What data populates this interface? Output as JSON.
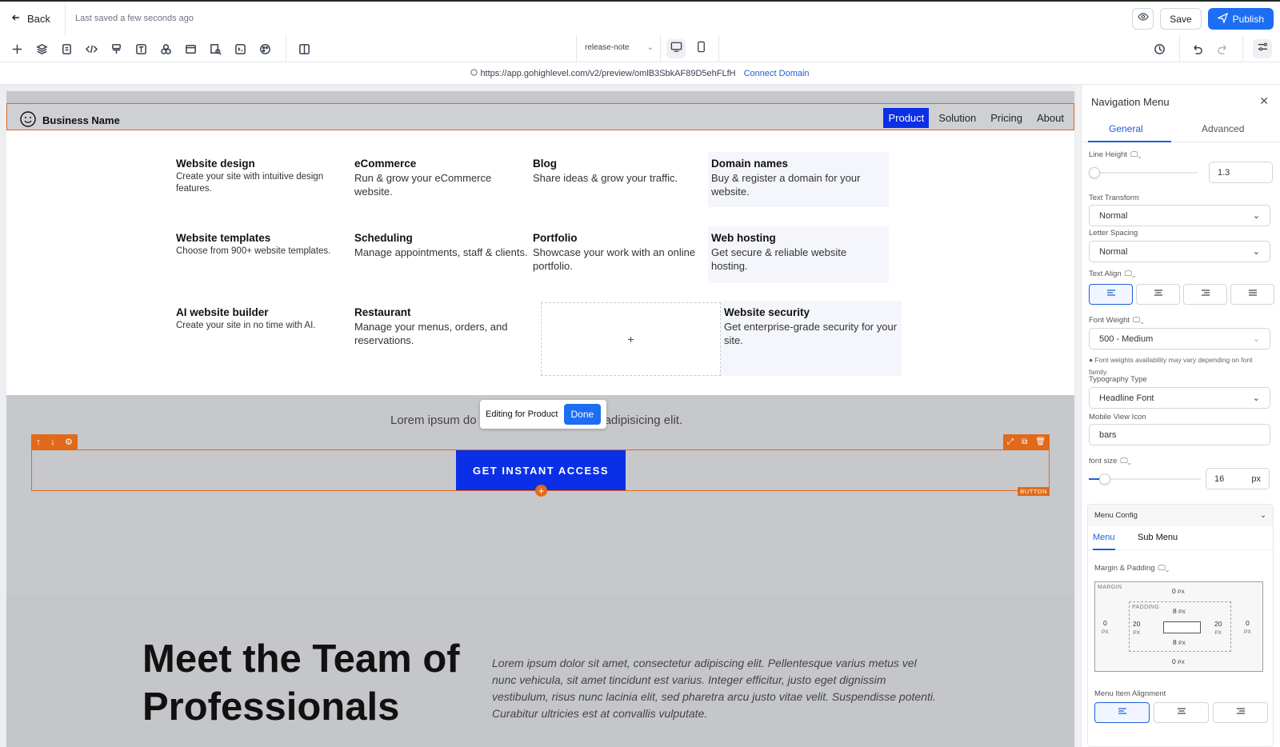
{
  "topbar": {
    "back_label": "Back",
    "saved_status": "Last saved a few seconds ago",
    "save_label": "Save",
    "publish_label": "Publish"
  },
  "toolbar": {
    "tools": [
      "plus-icon",
      "layers-icon",
      "pages-icon",
      "code-icon",
      "brush-icon",
      "text-icon",
      "elements-icon",
      "browser-icon",
      "seo-icon",
      "terminal-icon",
      "palette-icon",
      "columns-icon"
    ],
    "release_select": "release-note"
  },
  "urlbar": {
    "url": "https://app.gohighlevel.com/v2/preview/omlB3SbkAF89D5ehFLfH",
    "connect_label": "Connect Domain"
  },
  "site": {
    "brand": "Business Name",
    "nav": [
      {
        "label": "Product",
        "active": true
      },
      {
        "label": "Solution",
        "active": false
      },
      {
        "label": "Pricing",
        "active": false
      },
      {
        "label": "About",
        "active": false
      }
    ],
    "menu_items": [
      {
        "title": "Website design",
        "desc": "Create your site with intuitive design features."
      },
      {
        "title": "eCommerce",
        "desc": "Run & grow your eCommerce website."
      },
      {
        "title": "Blog",
        "desc": "Share ideas & grow your traffic."
      },
      {
        "title": "Domain names",
        "desc": "Buy & register a domain for your website."
      },
      {
        "title": "Website templates",
        "desc": "Choose from 900+ website templates."
      },
      {
        "title": "Scheduling",
        "desc": "Manage appointments, staff & clients."
      },
      {
        "title": "Portfolio",
        "desc": "Showcase your work with an online portfolio."
      },
      {
        "title": "Web hosting",
        "desc": "Get secure & reliable website hosting."
      },
      {
        "title": "AI website builder",
        "desc": "Create your site in no time with AI."
      },
      {
        "title": "Restaurant",
        "desc": "Manage your menus, orders, and reservations."
      },
      {
        "title": "Website security",
        "desc": "Get enterprise-grade security for your site."
      }
    ],
    "add_item_symbol": "+",
    "lorem_line": "Lorem ipsum do",
    "lorem_line_end": "adipisicing elit.",
    "editing_label": "Editing for Product",
    "done_label": "Done",
    "cta_label": "GET INSTANT ACCESS",
    "button_tag": "BUTTON",
    "team_heading": "Meet the Team of Professionals",
    "team_text": "Lorem ipsum dolor sit amet, consectetur adipiscing elit. Pellentesque varius metus vel nunc vehicula, sit amet tincidunt est varius. Integer efficitur, justo eget dignissim vestibulum, risus nunc lacinia elit, sed pharetra arcu justo vitae velit. Suspendisse potenti. Curabitur ultricies est at convallis vulputate."
  },
  "panel": {
    "title": "Navigation Menu",
    "tabs": [
      "General",
      "Advanced"
    ],
    "line_height_label": "Line Height",
    "line_height_value": "1.3",
    "line_height_fraction": 0.05,
    "text_transform_label": "Text Transform",
    "text_transform_value": "Normal",
    "letter_spacing_label": "Letter Spacing",
    "letter_spacing_value": "Normal",
    "text_align_label": "Text Align",
    "font_weight_label": "Font Weight",
    "font_weight_value": "500 - Medium",
    "font_weight_note": "Font weights availability may vary depending on font family.",
    "typography_label": "Typography Type",
    "typography_value": "Headline Font",
    "mobile_icon_label": "Mobile View Icon",
    "mobile_icon_value": "bars",
    "font_size_label": "font size",
    "font_size_value": "16",
    "font_size_unit": "px",
    "font_size_fraction": 0.14,
    "menu_config_label": "Menu Config",
    "menu_tabs": [
      "Menu",
      "Sub Menu"
    ],
    "margin_padding_label": "Margin & Padding",
    "margin_label": "MARGIN",
    "padding_label": "PADDING",
    "margin": {
      "top": "0",
      "right": "0",
      "bottom": "0",
      "left": "0"
    },
    "padding": {
      "top": "8",
      "right": "20",
      "bottom": "8",
      "left": "20"
    },
    "unit": "PX",
    "menu_item_alignment_label": "Menu Item Alignment"
  },
  "colors": {
    "accent": "#1c6ef2",
    "nav_active": "#0b2fe6",
    "selection": "#e06a1a"
  }
}
